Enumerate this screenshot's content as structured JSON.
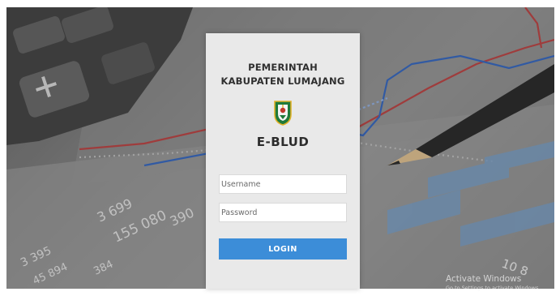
{
  "panel": {
    "title_line1": "PEMERINTAH",
    "title_line2": "KABUPATEN LUMAJANG",
    "app_name": "E-BLUD"
  },
  "form": {
    "username_placeholder": "Username",
    "password_placeholder": "Password",
    "login_label": "LOGIN"
  },
  "background": {
    "numbers": [
      "3 699",
      "155 080",
      "390",
      "3 395",
      "45 894",
      "384",
      "10 8"
    ]
  },
  "watermark": {
    "title": "Activate Windows",
    "subtitle": "Go to Settings to activate Windows."
  },
  "colors": {
    "accent": "#3c8dd8",
    "panel": "#e9e9e9"
  }
}
